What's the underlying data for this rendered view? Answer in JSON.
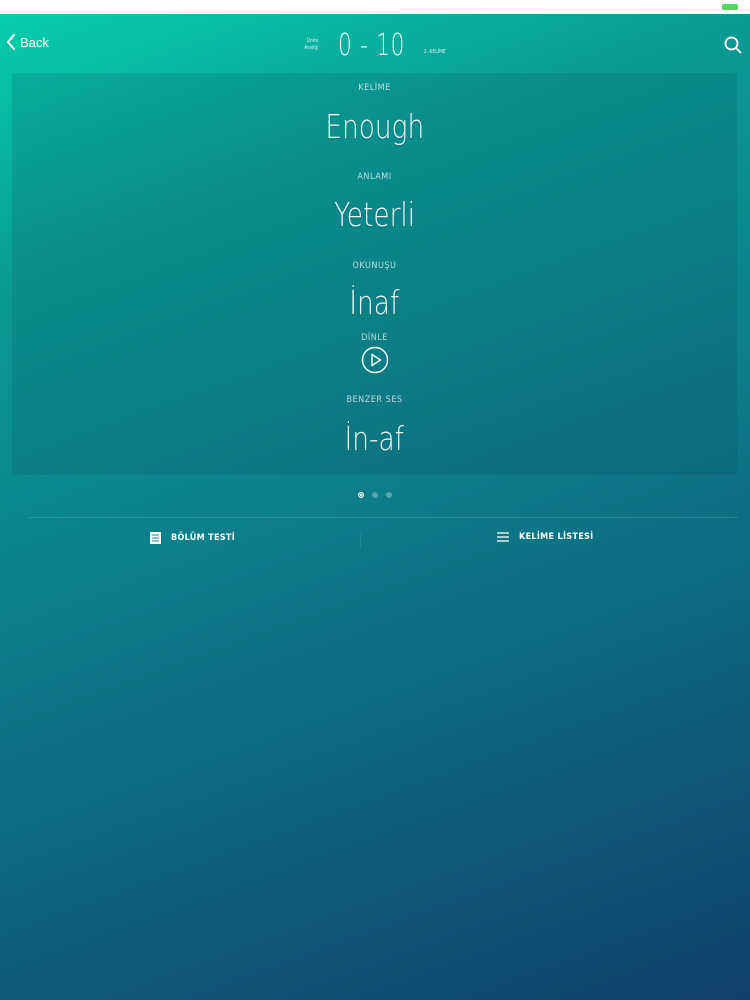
{
  "header": {
    "back_label": "Back",
    "range_small_top": "Ünite",
    "range_small_bottom": "Aralığı",
    "range_text": "0 - 10",
    "range_right": "2. KELİME"
  },
  "card": {
    "word_label": "KELİME",
    "word": "Enough",
    "meaning_label": "ANLAMI",
    "meaning": "Yeterli",
    "pronunciation_label": "OKUNUŞU",
    "pronunciation": "İnaf",
    "listen_label": "DİNLE",
    "similar_label": "BENZER SES",
    "similar": "İn-af"
  },
  "pager": {
    "count": 3,
    "active": 0
  },
  "bottom": {
    "test_label": "BÖLÜM TESTİ",
    "list_label": "KELİME LİSTESİ"
  },
  "icons": [
    "chevron-left-icon",
    "search-icon",
    "play-icon",
    "test-list-icon",
    "menu-icon"
  ],
  "colors": {
    "gradient_start": "#06d1ac",
    "gradient_end": "#10406a",
    "battery": "#4cd964"
  }
}
